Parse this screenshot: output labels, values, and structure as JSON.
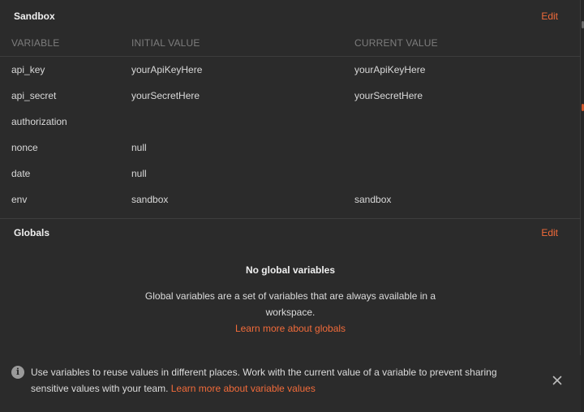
{
  "sandbox": {
    "title": "Sandbox",
    "edit_label": "Edit",
    "columns": {
      "variable": "VARIABLE",
      "initial": "INITIAL VALUE",
      "current": "CURRENT VALUE"
    },
    "rows": [
      {
        "variable": "api_key",
        "initial": "yourApiKeyHere",
        "current": "yourApiKeyHere"
      },
      {
        "variable": "api_secret",
        "initial": "yourSecretHere",
        "current": "yourSecretHere"
      },
      {
        "variable": "authorization",
        "initial": "",
        "current": ""
      },
      {
        "variable": "nonce",
        "initial": "null",
        "current": ""
      },
      {
        "variable": "date",
        "initial": "null",
        "current": ""
      },
      {
        "variable": "env",
        "initial": "sandbox",
        "current": "sandbox"
      }
    ]
  },
  "globals": {
    "title": "Globals",
    "edit_label": "Edit",
    "empty_title": "No global variables",
    "empty_description": "Global variables are a set of variables that are always available in a workspace.",
    "learn_more": "Learn more about globals"
  },
  "tip": {
    "icon": "info-icon",
    "text": "Use variables to reuse values in different places. Work with the current value of a variable to prevent sharing sensitive values with your team.",
    "link": "Learn more about variable values",
    "close_icon": "close-icon"
  },
  "colors": {
    "background": "#2b2b2b",
    "accent": "#f26b3a",
    "muted": "#7d7d7d"
  }
}
